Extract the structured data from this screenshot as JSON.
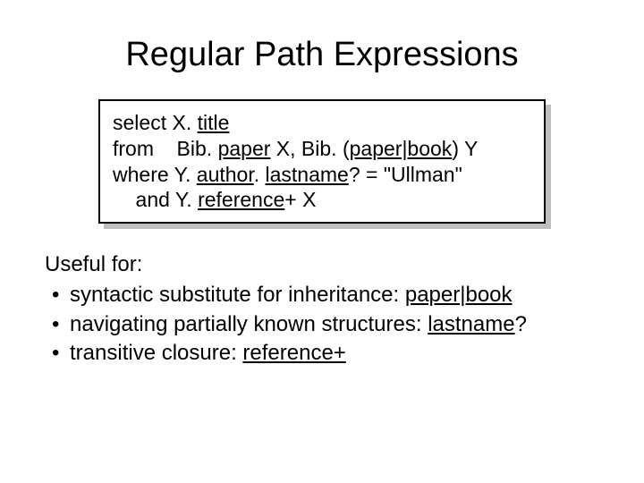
{
  "title": "Regular Path Expressions",
  "code": {
    "l1a": "select X. ",
    "l1b": "title",
    "l2a": "from    Bib. ",
    "l2b": "paper",
    "l2c": " X, Bib. (",
    "l2d": "paper|book",
    "l2e": ") Y",
    "l3a": "where Y. ",
    "l3b": "author",
    "l3c": ". ",
    "l3d": "lastname",
    "l3e": "? = \"Ullman\"",
    "l4a": "    and Y. ",
    "l4b": "reference",
    "l4c": "+ X"
  },
  "body": {
    "lead": "Useful for:",
    "b1a": "syntactic substitute for inheritance: ",
    "b1b": "paper|book",
    "b2a": "navigating partially known structures: ",
    "b2b": "lastname",
    "b2c": "?",
    "b3a": "transitive closure: ",
    "b3b": "reference+"
  }
}
